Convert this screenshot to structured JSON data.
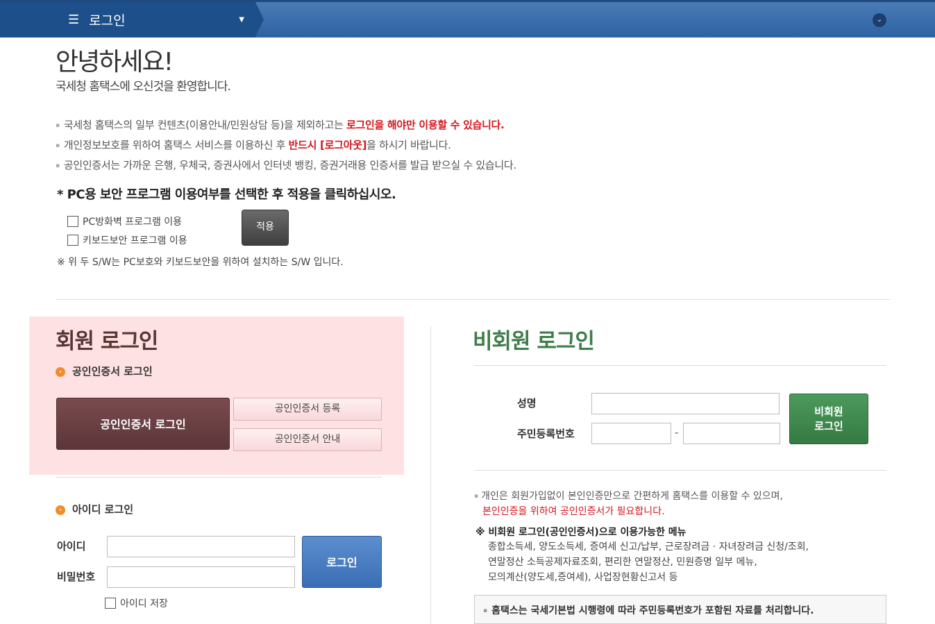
{
  "topbar": {
    "menu_icon": "hamburger-icon",
    "menu_title": "로그인",
    "caret": "▼",
    "right_icon": "chevron-down-icon",
    "right_glyph": "⌄"
  },
  "greeting": {
    "title": "안녕하세요!",
    "subtitle": "국세청 홈택스에 오신것을 환영합니다."
  },
  "notices": {
    "line1_pre": "국세청 홈택스의 일부 컨텐츠(이용안내/민원상담 등)을 제외하고는 ",
    "line1_red": "로그인을 해야만 이용할 수 있습니다.",
    "line2_pre": "개인정보보호를 위하여 홈택스 서비스를 이용하신 후 ",
    "line2_red": "반드시 [로그아웃]",
    "line2_post": "을 하시기 바랍니다.",
    "line3": "공인인증서는 가까운 은행, 우체국, 증권사에서 인터넷 뱅킹, 증권거래용 인증서를 발급 받으실 수 있습니다."
  },
  "security": {
    "title": "* PC용 보안 프로그램 이용여부를 선택한 후 적용을 클릭하십시오.",
    "firewall_label": "PC방화벽 프로그램 이용",
    "keyboard_label": "키보드보안 프로그램 이용",
    "apply_label": "적용",
    "note": "※ 위 두 S/W는 PC보호와 키보드보안을 위하여 설치하는 S/W 입니다."
  },
  "member": {
    "title": "회원 로그인",
    "cert_heading": "공인인증서 로그인",
    "cert_login_label": "공인인증서 로그인",
    "cert_register_label": "공인인증서 등록",
    "cert_guide_label": "공인인증서 안내",
    "id_heading": "아이디 로그인",
    "id_label": "아이디",
    "pw_label": "비밀번호",
    "login_label": "로그인",
    "save_id_label": "아이디 저장",
    "id_value": "",
    "pw_value": ""
  },
  "nonmember": {
    "title": "비회원 로그인",
    "name_label": "성명",
    "rrn_label": "주민등록번호",
    "dash": "-",
    "btn_line1": "비회원",
    "btn_line2": "로그인",
    "note_line1": "개인은 회원가입없이 본인인증만으로 간편하게 홈택스를 이용할 수 있으며,",
    "note_line2_red": "본인인증을 위하여 공인인증서가 필요합니다.",
    "menu_title": "※ 비회원 로그인(공인인증서)으로 이용가능한 메뉴",
    "menu_line1": "종합소득세, 양도소득세, 증여세 신고/납부, 근로장려금 · 자녀장려금 신청/조회,",
    "menu_line2": "연말정산 소득공제자료조회, 편리한 연말정산, 민원증명 일부 메뉴,",
    "menu_line3": "모의계산(양도세,증여세), 사업장현황신고서 등",
    "notice_box": "홈택스는 국세기본법 시행령에 따라 주민등록번호가 포함된 자료를 처리합니다."
  },
  "colors": {
    "topbar": "#2d62a3",
    "member_bg": "#fee2e3",
    "member_title": "#5a3535",
    "nonmember_title": "#3f7d4a",
    "red": "#d4161c"
  }
}
